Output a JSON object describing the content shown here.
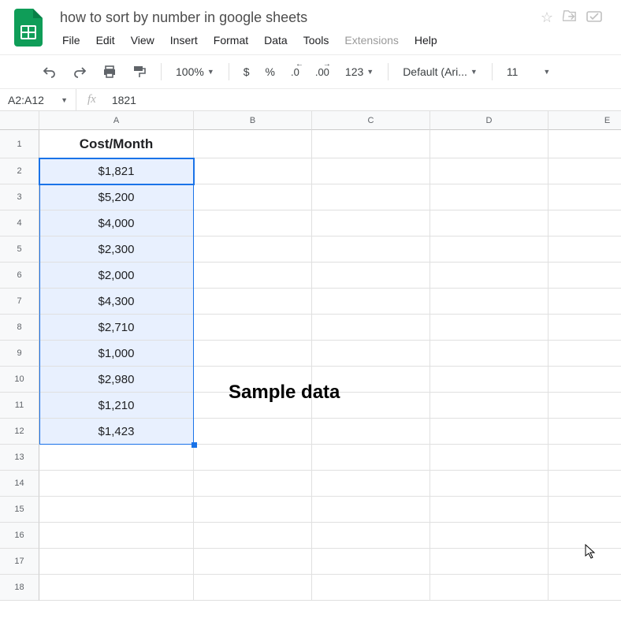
{
  "doc": {
    "title": "how to sort by number in google sheets"
  },
  "menu": {
    "items": [
      "File",
      "Edit",
      "View",
      "Insert",
      "Format",
      "Data",
      "Tools",
      "Extensions",
      "Help"
    ]
  },
  "toolbar": {
    "zoom": "100%",
    "currency": "$",
    "percent": "%",
    "dec_less": ".0",
    "dec_more": ".00",
    "format123": "123",
    "font": "Default (Ari...",
    "fontsize": "11"
  },
  "namebox": "A2:A12",
  "formula_value": "1821",
  "columns": [
    "A",
    "B",
    "C",
    "D",
    "E"
  ],
  "row_count": 18,
  "sheet": {
    "header": "Cost/Month",
    "values": [
      "$1,821",
      "$5,200",
      "$4,000",
      "$2,300",
      "$2,000",
      "$4,300",
      "$2,710",
      "$1,000",
      "$2,980",
      "$1,210",
      "$1,423"
    ]
  },
  "overlay": "Sample data"
}
